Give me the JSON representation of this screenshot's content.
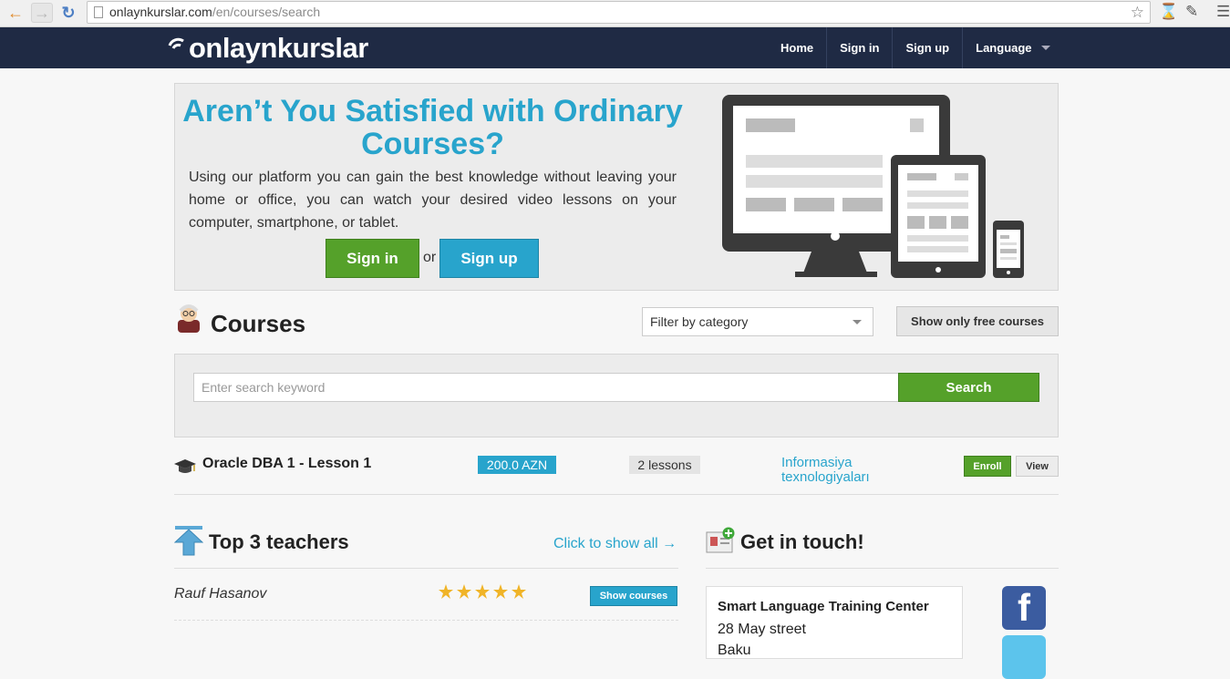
{
  "browser": {
    "url_domain": "onlaynkurslar.com",
    "url_path": "/en/courses/search"
  },
  "navbar": {
    "logo": "onlaynkurslar",
    "items": [
      {
        "label": "Home"
      },
      {
        "label": "Sign in"
      },
      {
        "label": "Sign up"
      },
      {
        "label": "Language"
      }
    ]
  },
  "hero": {
    "title": "Aren’t You Satisfied with Ordinary Courses?",
    "description": "Using our platform you can gain the best knowledge without leaving your home or office, you can watch your desired video lessons on your computer, smartphone, or tablet.",
    "signin_label": "Sign in",
    "or_text": "or",
    "signup_label": "Sign up"
  },
  "courses": {
    "title": "Courses",
    "filter_label": "Filter by category",
    "free_button": "Show only free courses",
    "search_placeholder": "Enter search keyword",
    "search_button": "Search",
    "items": [
      {
        "title": "Oracle DBA 1 - Lesson 1",
        "price": "200.0 AZN",
        "lessons": "2 lessons",
        "category": "Informasiya texnologiyaları",
        "enroll_label": "Enroll",
        "view_label": "View"
      }
    ]
  },
  "teachers": {
    "title": "Top 3 teachers",
    "show_all": "Click to show all →",
    "items": [
      {
        "name": "Rauf Hasanov",
        "rating": 5,
        "button": "Show courses"
      }
    ]
  },
  "contact": {
    "title": "Get in touch!",
    "name": "Smart Language Training Center",
    "street": "28 May street",
    "city": "Baku"
  },
  "colors": {
    "navbar": "#1f2a44",
    "accent_blue": "#28a4cc",
    "accent_green": "#55a12a"
  }
}
